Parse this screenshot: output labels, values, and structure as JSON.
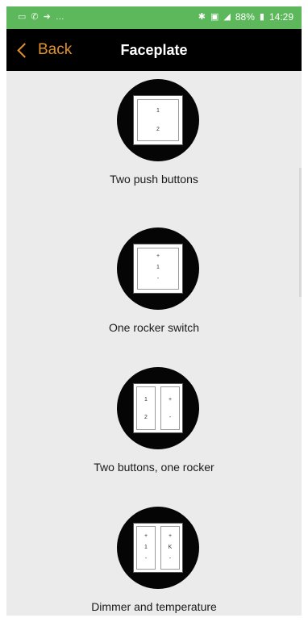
{
  "status_bar": {
    "left_icons": [
      "image-icon",
      "phone-icon",
      "arrow-icon",
      "more-icon"
    ],
    "battery": "88%",
    "time": "14:29"
  },
  "app_bar": {
    "back_label": "Back",
    "title": "Faceplate"
  },
  "options": [
    {
      "label": "Two push buttons",
      "glyphs": [
        "1",
        "2"
      ]
    },
    {
      "label": "One rocker switch",
      "glyphs": [
        "+",
        "1",
        "-"
      ]
    },
    {
      "label": "Two buttons, one rocker",
      "left_glyphs": [
        "1",
        "2"
      ],
      "right_glyphs": [
        "+",
        "-"
      ]
    },
    {
      "label": "Dimmer and temperature",
      "left_glyphs": [
        "+",
        "1",
        "-"
      ],
      "right_glyphs": [
        "+",
        "K",
        "-"
      ]
    }
  ],
  "colors": {
    "status_bar": "#5cb85a",
    "app_bar": "#000000",
    "accent": "#e0922b",
    "background": "#ebebeb"
  }
}
